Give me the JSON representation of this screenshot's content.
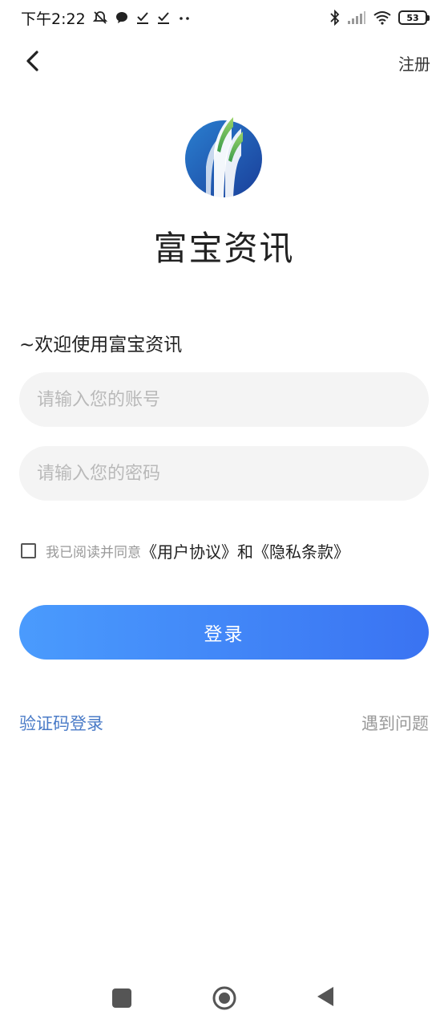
{
  "status_bar": {
    "time": "下午2:22",
    "battery": "53",
    "left_icons": [
      "mute-icon",
      "chat-icon",
      "check-icon",
      "check-icon",
      "more-dots-icon"
    ],
    "right_icons": [
      "bluetooth-icon",
      "signal-icon",
      "wifi-icon",
      "battery-icon"
    ]
  },
  "nav": {
    "back_icon": "chevron-left-icon",
    "register_label": "注册"
  },
  "app": {
    "title": "富宝资讯"
  },
  "form": {
    "welcome": "~欢迎使用富宝资讯",
    "account_placeholder": "请输入您的账号",
    "password_placeholder": "请输入您的密码",
    "agreement_prefix": "我已阅读并同意",
    "user_agreement": "《用户协议》",
    "and": "和",
    "privacy_policy": "《隐私条款》",
    "login_label": "登录",
    "code_login_label": "验证码登录",
    "problem_label": "遇到问题"
  },
  "colors": {
    "accent_start": "#4a9bfd",
    "accent_end": "#3a73f2",
    "link": "#4a7bc7",
    "input_bg": "#f4f4f4"
  }
}
